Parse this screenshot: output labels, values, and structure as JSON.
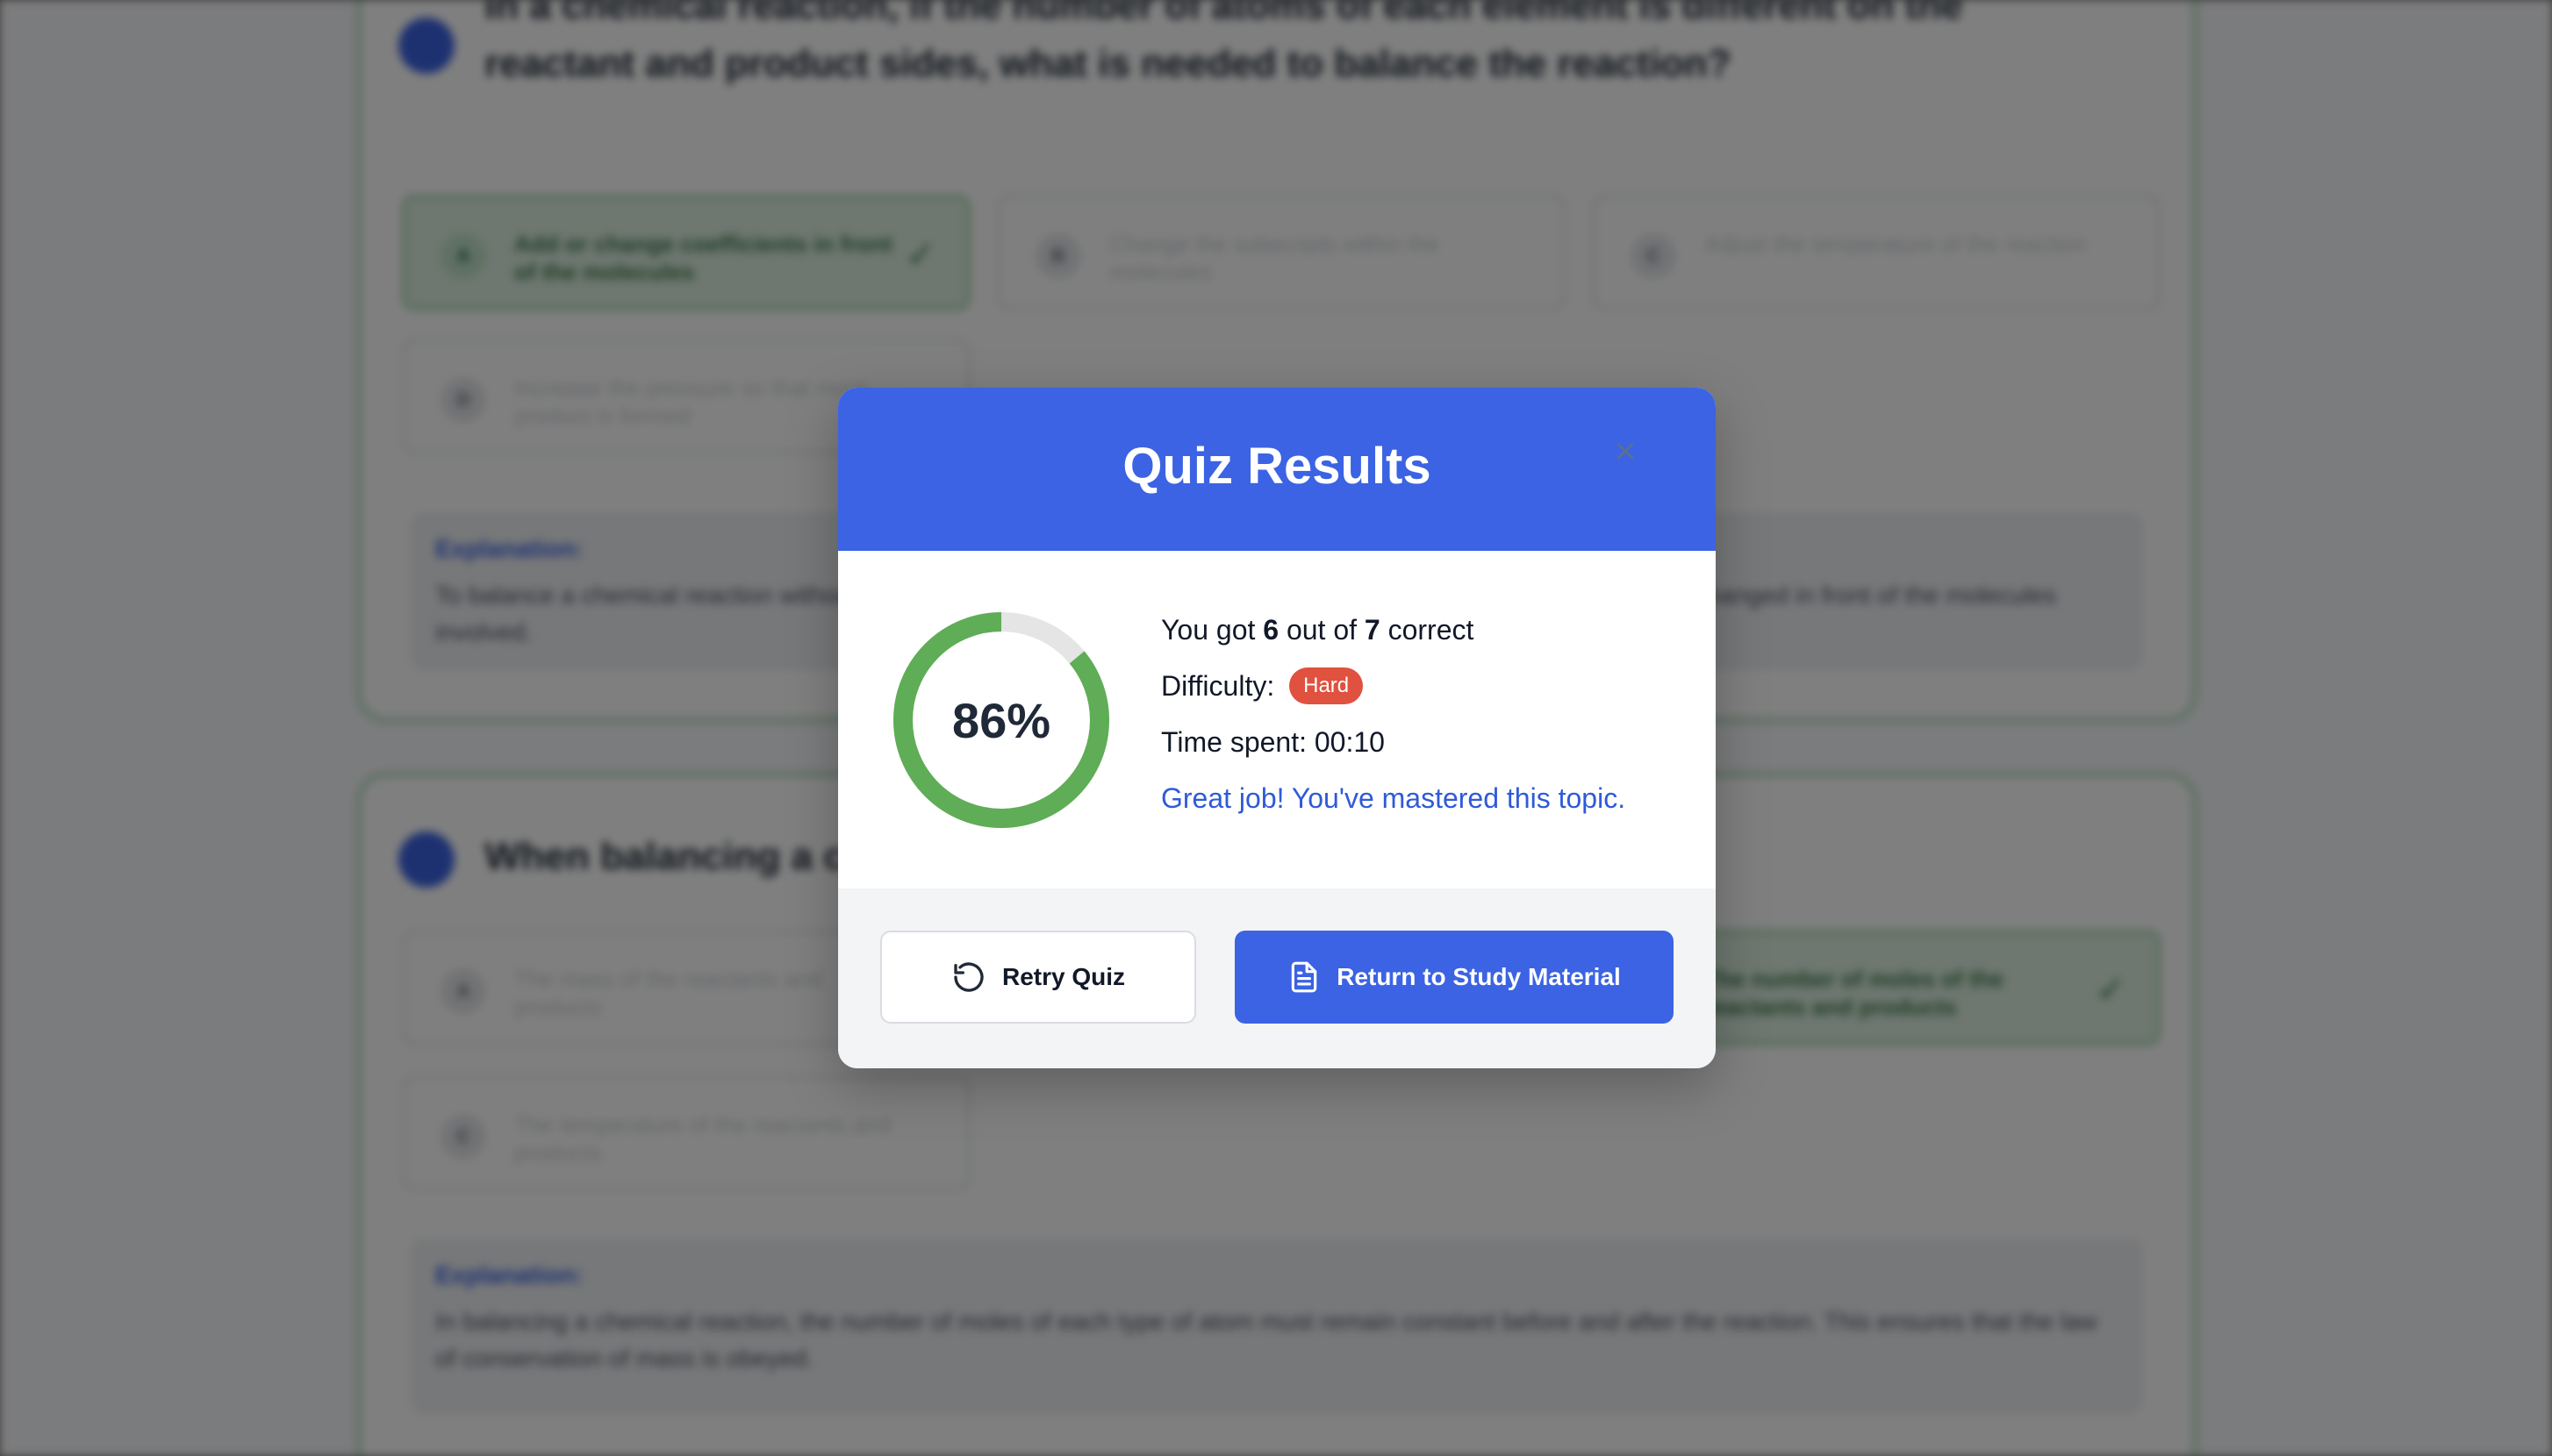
{
  "background": {
    "question_1": {
      "text": "In a chemical reaction, if the number of atoms of each element is different on the reactant and product sides, what is needed to balance the reaction?",
      "options": [
        {
          "letter": "A",
          "text": "Add or change coefficients in front of the molecules",
          "correct": true
        },
        {
          "letter": "B",
          "text": "Change the subscripts within the molecules",
          "correct": false
        },
        {
          "letter": "C",
          "text": "Adjust the temperature of the reaction",
          "correct": false
        },
        {
          "letter": "D",
          "text": "Increase the pressure so that more product is formed",
          "correct": false
        }
      ],
      "explanation_label": "Explanation:",
      "explanation": "To balance a chemical reaction without altering the identity of the substances involved, coefficients can be added or changed in front of the molecules involved."
    },
    "question_2": {
      "text": "When balancing a chemical equation, what must remain constant?",
      "options": [
        {
          "letter": "A",
          "text": "The mass of the reactants and products",
          "correct": false
        },
        {
          "letter": "B",
          "text": "The number of moles of the reactants and products",
          "correct": true
        },
        {
          "letter": "C",
          "text": "The temperature of the reactants and products",
          "correct": false
        }
      ],
      "explanation_label": "Explanation:",
      "explanation": "In balancing a chemical reaction, the number of moles of each type of atom must remain constant before and after the reaction. This ensures that the law of conservation of mass is obeyed."
    }
  },
  "modal": {
    "title": "Quiz Results",
    "close_icon": "close-icon",
    "score": {
      "percent_label": "86%",
      "fraction": 0.86,
      "ring_color": "#5fad56",
      "track_color": "#e5e5e5"
    },
    "stats": {
      "got_prefix": "You got ",
      "correct_count": "6",
      "out_of": " out of ",
      "total_count": "7",
      "correct_suffix": " correct",
      "difficulty_label": "Difficulty: ",
      "difficulty_value": "Hard",
      "time_label": "Time spent: ",
      "time_value": "00:10",
      "message": "Great job! You've mastered this topic."
    },
    "buttons": {
      "retry": {
        "label": "Retry Quiz",
        "icon": "retry-icon"
      },
      "return": {
        "label": "Return to Study Material",
        "icon": "document-icon"
      }
    }
  },
  "colors": {
    "accent": "#3b63e3",
    "success": "#5fad56",
    "danger_badge": "#e0513f"
  }
}
